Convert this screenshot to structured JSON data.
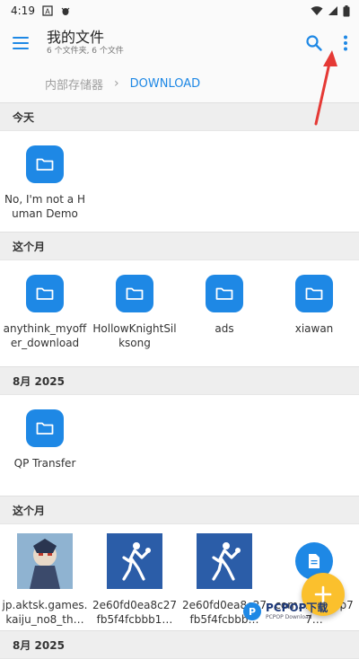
{
  "status_bar": {
    "time": "4:19"
  },
  "header": {
    "title": "我的文件",
    "subtitle": "6 个文件夹, 6 个文件"
  },
  "breadcrumb": {
    "parent": "内部存储器",
    "current": "DOWNLOAD"
  },
  "sections": [
    {
      "title": "今天",
      "items": [
        {
          "label": "No, I'm not a Human Demo",
          "icon": "folder-icon"
        }
      ]
    },
    {
      "title": "这个月",
      "items": [
        {
          "label": "anythink_myoffer_download",
          "icon": "folder-icon"
        },
        {
          "label": "HollowKnightSilksong",
          "icon": "folder-icon"
        },
        {
          "label": "ads",
          "icon": "folder-icon"
        },
        {
          "label": "xiawan",
          "icon": "folder-icon"
        }
      ]
    },
    {
      "title": "8月 2025",
      "items": [
        {
          "label": "QP Transfer",
          "icon": "folder-icon"
        }
      ]
    },
    {
      "title": "这个月",
      "items": [
        {
          "label": "jp.aktsk.games.kaiju_no8_th…",
          "icon": "image-thumbnail"
        },
        {
          "label": "2e60fd0ea8c27fb5f4fcbbb1…",
          "icon": "player-thumbnail"
        },
        {
          "label": "2e60fd0ea8c27fb5f4fcbbb…",
          "icon": "player-thumbnail"
        },
        {
          "label": "com.…a.…up77…",
          "icon": "document-icon"
        }
      ]
    },
    {
      "title": "8月 2025"
    }
  ],
  "watermark": {
    "brand": "PCPOP下载",
    "tagline": "PCPOP Download"
  },
  "colors": {
    "accent": "#1e88e5",
    "fab": "#fbc02d",
    "arrow": "#e53935"
  }
}
